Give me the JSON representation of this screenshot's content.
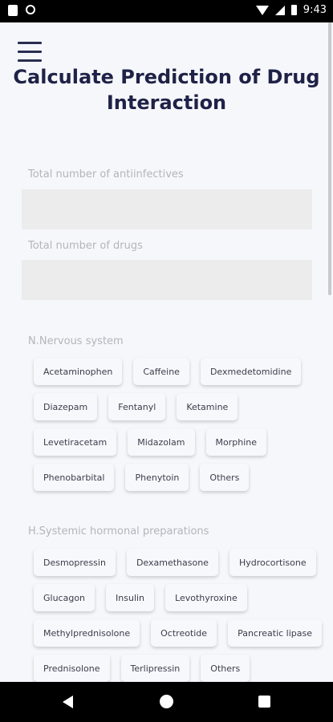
{
  "status_bar": {
    "time": "9:43"
  },
  "page": {
    "title": "Calculate Prediction of Drug Interaction"
  },
  "form": {
    "antiinfectives_label": "Total number of antiinfectives",
    "antiinfectives_value": "",
    "drugs_label": "Total number of drugs",
    "drugs_value": ""
  },
  "sections": [
    {
      "title": "N.Nervous system",
      "chips": [
        "Acetaminophen",
        "Caffeine",
        "Dexmedetomidine",
        "Diazepam",
        "Fentanyl",
        "Ketamine",
        "Levetiracetam",
        "Midazolam",
        "Morphine",
        "Phenobarbital",
        "Phenytoin",
        "Others"
      ]
    },
    {
      "title": "H.Systemic hormonal preparations",
      "chips": [
        "Desmopressin",
        "Dexamethasone",
        "Hydrocortisone",
        "Glucagon",
        "Insulin",
        "Levothyroxine",
        "Methylprednisolone",
        "Octreotide",
        "Pancreatic lipase",
        "Prednisolone",
        "Terlipressin",
        "Others"
      ]
    }
  ]
}
